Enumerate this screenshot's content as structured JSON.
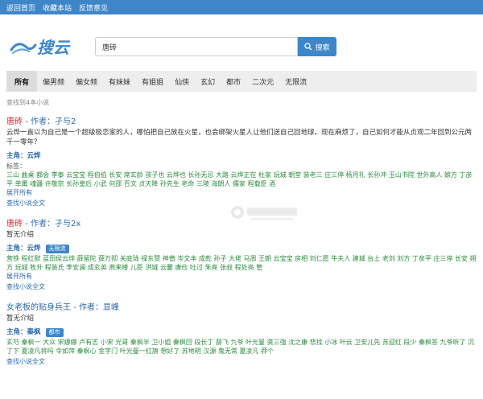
{
  "topnav": {
    "home": "返回首页",
    "bookmark": "收藏本站",
    "feedback": "反馈意见"
  },
  "search": {
    "value": "唐砖",
    "button_label": "搜索"
  },
  "tabs": [
    "所有",
    "偏男频",
    "偏女频",
    "有妹妹",
    "有姐姐",
    "仙侠",
    "玄幻",
    "都市",
    "二次元",
    "无限流"
  ],
  "result_count": "查找到4本小说",
  "results": [
    {
      "title_kw": "唐砖",
      "title_rest": " - 作者：孑与2",
      "intro": "云烨一直以为自己是一个超级极恋家的人，哪怕把自己放在火星，也会绑架火星人让他们送自己回地球。现在麻烦了，自己如何才能从贞观二年回到公元两千一零年？",
      "protagonist": "主角：云烨",
      "badge": "",
      "tags_label": "标签：",
      "tags": "三山 曲桌 都会 李泰 云宝宝 程伯伯 长安 席玄龄 孩子也 云烨也 长孙无忌 大路 云烨正在 杜家 玩城 朝堂 装老三 庄三停 杨月礼 长孙冲 玉山书院 世外高人 娘方 丁彦平 单鹰 魂疆 许敬宗 长孙皇后 小武 何邵 百文 贞天降 孙先生 老命 三陵 海朗人 儒家 程载臣 酒",
      "expand": "展开所有",
      "fulltext": "查找小说全文"
    },
    {
      "title_kw": "唐砖",
      "title_rest": " - 作者：孑与2x",
      "intro": "暂无介绍",
      "protagonist": "主角：云烨",
      "badge": "无限流",
      "tags_label": "",
      "tags": "营铁 程红默 蓝田侯云烨 薛留陀 薛万彻 关庭珑 禄东赞 神僧 岑文本 成乾 孙子 大佬 马周 王朗 云宝宝 房相 刘仁愿 牛夫人 建城 台上 老刘 刘方 丁彦平 庄三停 长安 朔方 玩城 牧升 程装氏 李安澜 成玄英 燕来楼 儿臣 洪城 云馨 唐俭 吐过 朱亮 张叔 程处亮 管",
      "expand": "展开所有",
      "fulltext": "查找小说全文"
    },
    {
      "title_kw": "",
      "title_rest": "女老板的贴身兵王 - 作者：显峰",
      "intro": "暂无介绍",
      "protagonist": "主角：秦枫",
      "badge": "都市",
      "tags_label": "",
      "tags": "玄芍 秦枫一 大众 宋娜娜 卢有志 小宋 光哥 秦枫半 卫小姐 秦枫回 段长丁 薛飞 九爷 叶光曼 龚三强 沈之康 悲找 小冰 叶云 卫安儿先 苏迎红 段少 秦枫答 九爷听了 沉了下 夏凌凡将吗 令如萍 秦枫心 金字门 叶光曼一红旗 想好了 苏地明 汉源 鬼无常 夏凌凡 莽个",
      "expand": "",
      "fulltext": "查找小说全文"
    }
  ],
  "colors": {
    "accent": "#3f86c9",
    "keyword": "#e0292f",
    "tag": "#2b8a3e"
  },
  "icons": {
    "search": "search-icon",
    "logo": "logo-icon",
    "watermark": "watermark-icon"
  }
}
